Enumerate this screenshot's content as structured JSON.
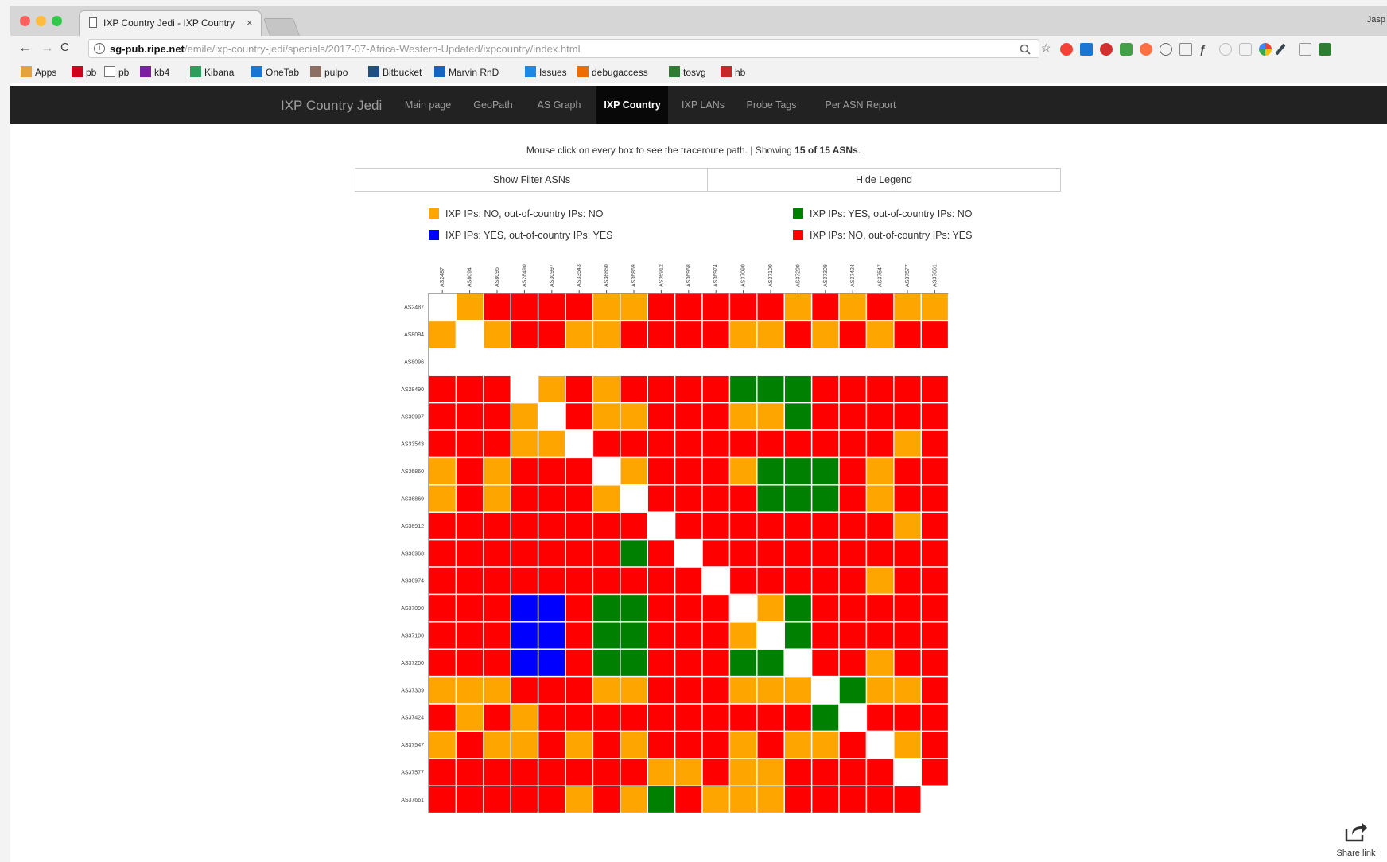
{
  "browser": {
    "tab_title": "IXP Country Jedi - IXP Country",
    "tab_close": "×",
    "profile_label": "Jasp",
    "url_host": "sg-pub.ripe.net",
    "url_path": "/emile/ixp-country-jedi/specials/2017-07-Africa-Western-Updated/ixpcountry/index.html",
    "nav_back": "←",
    "nav_forward": "→",
    "nav_reload": "C",
    "bookmarks": [
      {
        "label": "Apps",
        "icon": "apps-icon",
        "color": "#e6a23c"
      },
      {
        "label": "pb",
        "icon": "pb-red-icon",
        "color": "#d0021b"
      },
      {
        "label": "pb",
        "icon": "page-icon",
        "color": "#ffffff"
      },
      {
        "label": "kb4",
        "icon": "kb4-icon",
        "color": "#7b1fa2"
      },
      {
        "label": "Kibana",
        "icon": "kibana-icon",
        "color": "#2e9d5b"
      },
      {
        "label": "OneTab",
        "icon": "onetab-icon",
        "color": "#1976d2"
      },
      {
        "label": "pulpo",
        "icon": "pulpo-icon",
        "color": "#8d6e63"
      },
      {
        "label": "Bitbucket",
        "icon": "bitbucket-icon",
        "color": "#205081"
      },
      {
        "label": "Marvin RnD",
        "icon": "marvin-icon",
        "color": "#1565c0"
      },
      {
        "label": "Issues",
        "icon": "issues-icon",
        "color": "#1e88e5"
      },
      {
        "label": "debugaccess",
        "icon": "debug-icon",
        "color": "#ef6c00"
      },
      {
        "label": "tosvg",
        "icon": "tosvg-icon",
        "color": "#2e7d32"
      },
      {
        "label": "hb",
        "icon": "hb-icon",
        "color": "#c62828"
      }
    ]
  },
  "navbar": {
    "brand": "IXP Country Jedi",
    "links": [
      {
        "label": "Main page",
        "active": false
      },
      {
        "label": "GeoPath",
        "active": false
      },
      {
        "label": "AS Graph",
        "active": false
      },
      {
        "label": "IXP Country",
        "active": true
      },
      {
        "label": "IXP LANs",
        "active": false
      },
      {
        "label": "Probe Tags",
        "active": false
      },
      {
        "label": "Per ASN Report",
        "active": false
      }
    ]
  },
  "info": {
    "prefix": "Mouse click on every box to see the traceroute path. | Showing ",
    "count": "15 of 15 ASNs",
    "suffix": "."
  },
  "buttons": {
    "filter": "Show Filter ASNs",
    "legend": "Hide Legend"
  },
  "legend": [
    {
      "label": "IXP IPs: NO, out-of-country IPs: NO",
      "color": "#ffa500"
    },
    {
      "label": "IXP IPs: YES, out-of-country IPs: NO",
      "color": "#008000"
    },
    {
      "label": "IXP IPs: YES, out-of-country IPs: YES",
      "color": "#0000ff"
    },
    {
      "label": "IXP IPs: NO, out-of-country IPs: YES",
      "color": "#ff0000"
    }
  ],
  "matrix": {
    "codes": {
      "O": "#ffa500",
      "R": "#ff0000",
      "G": "#008000",
      "B": "#0000ff",
      "W": "#ffffff",
      "E": ""
    },
    "row_labels": [
      "AS2487",
      "AS8094",
      "AS8096",
      "AS28490",
      "AS30997",
      "AS33543",
      "AS36860",
      "AS36869",
      "AS36912",
      "AS36968",
      "AS36974",
      "AS37090",
      "AS37100",
      "AS37200",
      "AS37309",
      "AS37424",
      "AS37547",
      "AS37577",
      "AS37661"
    ],
    "col_labels": [
      "AS2487",
      "AS8094",
      "AS8096",
      "AS28490",
      "AS30997",
      "AS33543",
      "AS36860",
      "AS36869",
      "AS36912",
      "AS36968",
      "AS36974",
      "AS37090",
      "AS37100",
      "AS37200",
      "AS37309",
      "AS37424",
      "AS37547",
      "AS37577",
      "AS37661"
    ],
    "rows": [
      "WORRRROORRRRROROROO",
      "OWORROORRRROORORORR",
      "EEEEEEEEEEEEEEEEEEE",
      "RRRWORORRRRGGGRRRRR",
      "RRROWROORRROOGRRRRR",
      "RRROOWRRRRRRRRRRROR",
      "ORORRRWORRROGGGRORR",
      "ORORRROWRRRRGGGRORR",
      "RRRRRRRRWRRRRRRRROR",
      "RRRRRRRGRWRRRRRRRRR",
      "RRRRRRRRRRWRRRRRORR",
      "RRRBBRGGRRRWOGRRRRR",
      "RRRBBRGGRRROWGRRRRR",
      "RRRBBRGGRRRGGWRRORR",
      "OOORRROORRROOOWGOOR",
      "RORORRRRRRRRRRGWRRR",
      "OROORORORRROROORWOR",
      "RRRRRRRROOROORRRRWR",
      "RRRRROROGROOORRRRRE"
    ]
  },
  "share": {
    "label": "Share link"
  }
}
